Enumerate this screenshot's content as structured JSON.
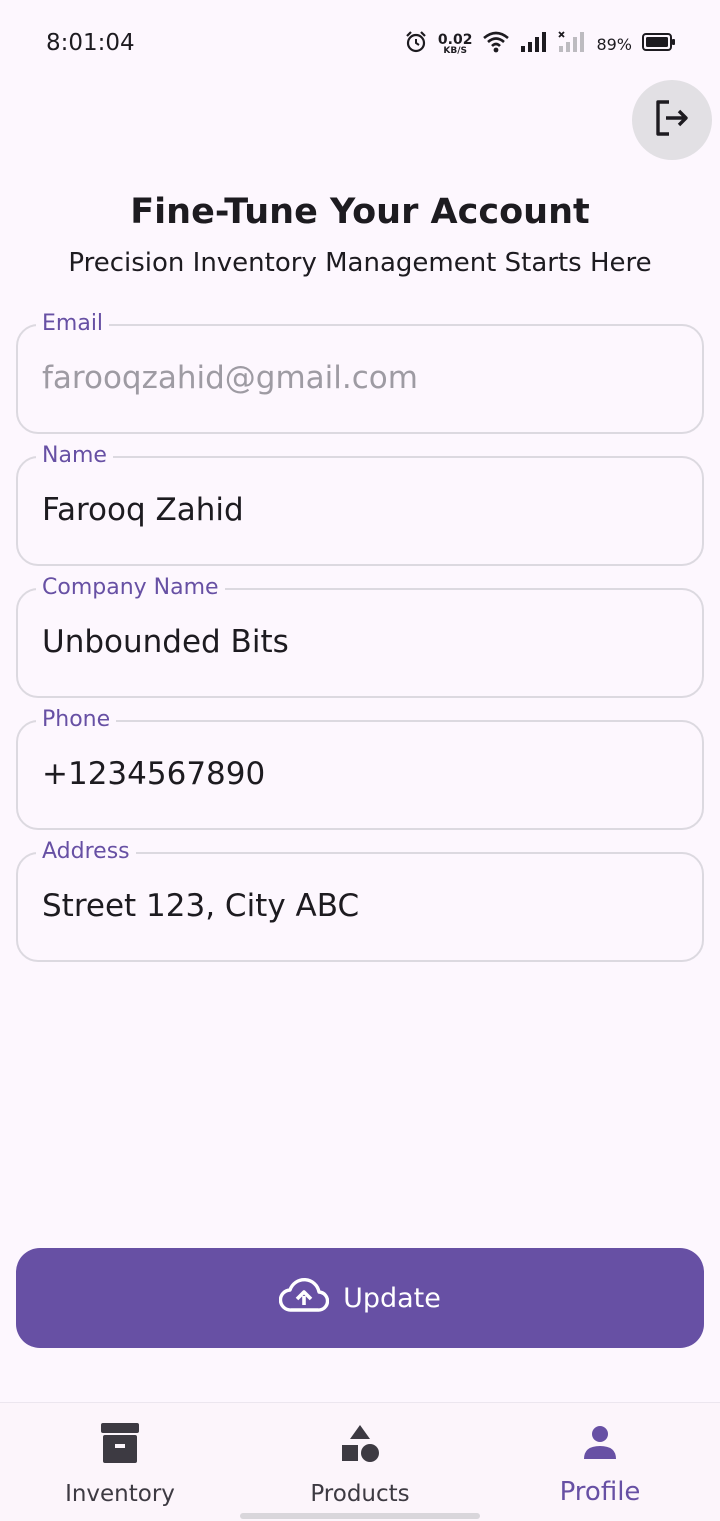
{
  "status_bar": {
    "time": "8:01:04",
    "net_speed_value": "0.02",
    "net_speed_unit": "KB/S",
    "battery_percent": "89%",
    "icons": [
      "alarm-icon",
      "wifi-icon",
      "signal-icon",
      "signal-no-sim-icon",
      "battery-icon"
    ]
  },
  "header": {
    "logout_icon": "logout-icon",
    "title": "Fine-Tune Your Account",
    "subtitle": "Precision Inventory Management Starts Here"
  },
  "form": {
    "email": {
      "label": "Email",
      "value": "farooqzahid@gmail.com",
      "enabled": false
    },
    "name": {
      "label": "Name",
      "value": "Farooq Zahid"
    },
    "company": {
      "label": "Company Name",
      "value": "Unbounded Bits"
    },
    "phone": {
      "label": "Phone",
      "value": "+1234567890"
    },
    "address": {
      "label": "Address",
      "value": "Street 123, City ABC"
    }
  },
  "update_button": {
    "label": "Update",
    "icon": "cloud-upload-icon"
  },
  "bottom_nav": {
    "items": [
      {
        "label": "Inventory",
        "icon": "archive-box-icon",
        "active": false
      },
      {
        "label": "Products",
        "icon": "shapes-icon",
        "active": false
      },
      {
        "label": "Profile",
        "icon": "person-icon",
        "active": true
      }
    ]
  },
  "colors": {
    "background": "#fdf7fe",
    "accent": "#6750a4",
    "field_border": "#dcd9e0",
    "disabled_text": "#9e9ba3"
  }
}
